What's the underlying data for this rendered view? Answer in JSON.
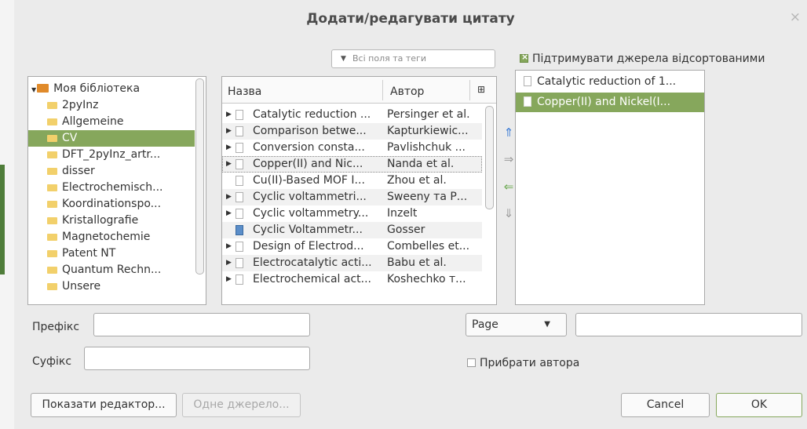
{
  "dialog": {
    "title": "Додати/редагувати цитату",
    "close_glyph": "×"
  },
  "search": {
    "placeholder": "Всі поля та теги",
    "dropdown_glyph": "▼"
  },
  "library": {
    "root": "Моя бібліотека",
    "folders": [
      "2pyInz",
      "Allgemeine",
      "CV",
      "DFT_2pyInz_artr...",
      "disser",
      "Electrochemisch...",
      "Koordinationspo...",
      "Kristallografie",
      "Magnetochemie",
      "Patent NT",
      "Quantum Rechn...",
      "Unsere"
    ],
    "selected_index": 2,
    "expand_glyph": "▼"
  },
  "items": {
    "col_title": "Назва",
    "col_author": "Автор",
    "col_picker_glyph": "⊞",
    "rows": [
      {
        "title": "Catalytic reduction ...",
        "author": "Persinger et al.",
        "has_children": true,
        "icon": "document-icon"
      },
      {
        "title": "Comparison betwe...",
        "author": "Kapturkiewic...",
        "has_children": true,
        "icon": "document-icon"
      },
      {
        "title": "Conversion consta...",
        "author": "Pavlishchuk ...",
        "has_children": true,
        "icon": "document-icon"
      },
      {
        "title": "Copper(II) and Nic...",
        "author": "Nanda et al.",
        "has_children": true,
        "icon": "document-icon"
      },
      {
        "title": "Cu(II)-Based MOF I...",
        "author": "Zhou et al.",
        "has_children": false,
        "icon": "document-icon"
      },
      {
        "title": "Cyclic voltammetri...",
        "author": "Sweeny та Р...",
        "has_children": true,
        "icon": "document-icon"
      },
      {
        "title": "Cyclic voltammetry...",
        "author": "Inzelt",
        "has_children": true,
        "icon": "document-icon"
      },
      {
        "title": "Cyclic Voltammetr...",
        "author": "Gosser",
        "has_children": false,
        "icon": "book-icon"
      },
      {
        "title": "Design of Electrod...",
        "author": "Combelles et...",
        "has_children": true,
        "icon": "document-icon"
      },
      {
        "title": "Electrocatalytic acti...",
        "author": "Babu et al.",
        "has_children": true,
        "icon": "document-icon"
      },
      {
        "title": "Electrochemical act...",
        "author": "Koshechko т...",
        "has_children": true,
        "icon": "document-icon"
      }
    ],
    "focused_index": 3,
    "twisty_glyph": "▶"
  },
  "arrows": {
    "up": "⇑",
    "right": "⇒",
    "left": "⇐",
    "down": "⇓",
    "active_color": "#3a7bd5",
    "green_color": "#6aa84f",
    "inactive_color": "#9a9a9a"
  },
  "citations": {
    "keep_sorted_label": "Підтримувати джерела відсортованими",
    "keep_sorted_checked": true,
    "rows": [
      "Catalytic reduction of 1...",
      "Copper(II) and Nickel(I..."
    ],
    "selected_index": 1
  },
  "fields": {
    "prefix_label": "Префікс",
    "prefix_value": "",
    "suffix_label": "Суфікс",
    "suffix_value": "",
    "locator_type": "Page",
    "locator_dropdown_glyph": "▼",
    "locator_value": "",
    "suppress_author_label": "Прибрати автора",
    "suppress_author_checked": false
  },
  "buttons": {
    "show_editor": "Показати редактор...",
    "single_source": "Одне джерело...",
    "cancel": "Cancel",
    "ok": "OK"
  },
  "colors": {
    "selection": "#86a75c",
    "dialog_bg": "#ebebeb"
  }
}
